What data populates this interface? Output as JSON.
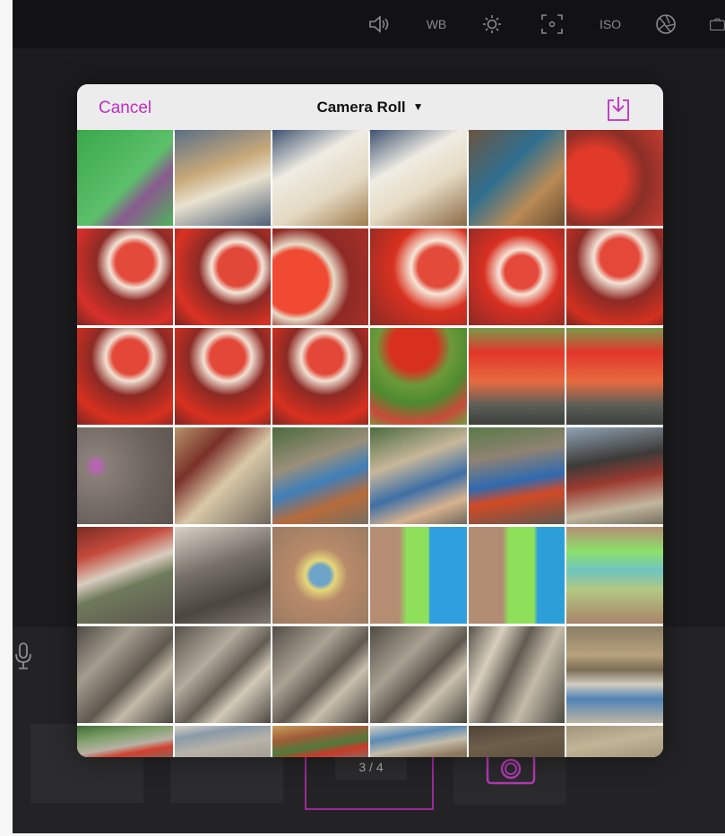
{
  "top_toolbar": {
    "tools": [
      {
        "icon": "speaker-icon",
        "label": ""
      },
      {
        "icon": "white-balance-label",
        "label": "WB"
      },
      {
        "icon": "brightness-icon",
        "label": ""
      },
      {
        "icon": "focus-frame-icon",
        "label": ""
      },
      {
        "icon": "iso-label",
        "label": "ISO"
      },
      {
        "icon": "aperture-icon",
        "label": ""
      },
      {
        "icon": "camera-switch-icon",
        "label": ""
      }
    ]
  },
  "picker": {
    "cancel_label": "Cancel",
    "album_title": "Camera Roll",
    "album_caret": "▼",
    "import_icon": "import-download-icon",
    "photos": [
      {
        "row": 0,
        "col": 0,
        "bg": "linear-gradient(135deg,#3aa84b 0%,#5cc06a 55%,#8a5a8e 70%,#4db35a 100%)"
      },
      {
        "row": 0,
        "col": 1,
        "bg": "linear-gradient(160deg,#5b6f86 0%,#c8a97a 40%,#e9e2cf 60%,#4d5f76 100%)"
      },
      {
        "row": 0,
        "col": 2,
        "bg": "linear-gradient(150deg,#3e5271 0%,#efece3 35%,#e3d9c3 65%,#a07c4c 100%)"
      },
      {
        "row": 0,
        "col": 3,
        "bg": "linear-gradient(150deg,#3e5271 0%,#efece3 35%,#e6dcc5 60%,#8b6a45 100%)"
      },
      {
        "row": 0,
        "col": 4,
        "bg": "linear-gradient(135deg,#6b5540 0%,#2f6f8f 40%,#b98a55 70%,#6a4f33 100%)"
      },
      {
        "row": 0,
        "col": 5,
        "bg": "radial-gradient(circle at 30% 50%,#e23a2a 0 35%,#8a2f27 60%,#c43b31 100%)"
      },
      {
        "row": 1,
        "col": 0,
        "bg": "radial-gradient(circle at 60% 35%,#e44a3a 0 22%,#f3e3d6 30%,#8d2b26 45%,#d8302a 75%,#7a2622 100%)"
      },
      {
        "row": 1,
        "col": 1,
        "bg": "radial-gradient(circle at 65% 40%,#e14838 0 22%,#f4e6d9 30%,#8b2a25 45%,#db3224 75%,#7b2420 100%)"
      },
      {
        "row": 1,
        "col": 2,
        "bg": "radial-gradient(circle at 25% 55%,#f04a32 0 35%,#e8dcc8 42%,#8f2a25 60%,#a83028 100%)"
      },
      {
        "row": 1,
        "col": 3,
        "bg": "radial-gradient(circle at 70% 40%,#e34a39 0 22%,#f5e6d8 30%,#d9311f 50%,#8a2a25 100%)"
      },
      {
        "row": 1,
        "col": 4,
        "bg": "radial-gradient(circle at 55% 45%,#e5493a 0 22%,#f4e5d7 30%,#d93022 50%,#8b2a25 100%)"
      },
      {
        "row": 1,
        "col": 5,
        "bg": "radial-gradient(circle at 55% 30%,#e44838 0 22%,#f3e3d6 30%,#8d2b26 50%,#d3301f 80%,#7a2622 100%)"
      },
      {
        "row": 2,
        "col": 0,
        "bg": "radial-gradient(circle at 55% 30%,#e24737 0 20%,#f2e1d3 28%,#8c2a25 45%,#d8301f 75%,#7a2622 100%)"
      },
      {
        "row": 2,
        "col": 1,
        "bg": "radial-gradient(circle at 55% 30%,#e24737 0 20%,#f2e1d3 28%,#8c2a25 45%,#d8301f 75%,#7a2622 100%)"
      },
      {
        "row": 2,
        "col": 2,
        "bg": "radial-gradient(circle at 55% 30%,#e24737 0 20%,#f2e1d3 28%,#8c2a25 45%,#d8301f 75%,#7a2622 100%)"
      },
      {
        "row": 2,
        "col": 3,
        "bg": "radial-gradient(circle at 45% 20%,#d8301f 0 25%,#6c9a3a 40%,#4f8a2f 60%,#c94a3a 80%,#6fa041 100%)"
      },
      {
        "row": 2,
        "col": 4,
        "bg": "linear-gradient(180deg,#7a9a4a 0%,#e2362a 25%,#e86a3f 55%,#5c5f58 80%,#3c3f3a 100%)"
      },
      {
        "row": 2,
        "col": 5,
        "bg": "linear-gradient(180deg,#7a9a4a 0%,#e2362a 25%,#e86a3f 55%,#5c5f58 80%,#3c3f3a 100%)"
      },
      {
        "row": 3,
        "col": 0,
        "bg": "radial-gradient(circle at 20% 40%,#b466b0 0 5%,#8a7f78 12%,#6b625c 60%,#5b534d 100%)"
      },
      {
        "row": 3,
        "col": 1,
        "bg": "linear-gradient(135deg,#b5946a 0%,#7a3028 30%,#d9c9a8 55%,#6f665c 100%)"
      },
      {
        "row": 3,
        "col": 2,
        "bg": "linear-gradient(160deg,#4b6b3e 0%,#9b8f7a 35%,#3f7fb9 55%,#b76b3a 75%,#776f63 100%)"
      },
      {
        "row": 3,
        "col": 3,
        "bg": "linear-gradient(160deg,#4b6b3e 0%,#c7b79a 35%,#3e6fa6 60%,#d7b28e 80%,#6e675d 100%)"
      },
      {
        "row": 3,
        "col": 4,
        "bg": "linear-gradient(170deg,#5a7a48 0%,#8f8273 30%,#2f6ab0 55%,#d24a25 70%,#5e5850 100%)"
      },
      {
        "row": 3,
        "col": 5,
        "bg": "linear-gradient(170deg,#8fa3b3 0%,#3d3a38 35%,#9b3a30 55%,#c2b69e 80%,#75705f 100%)"
      },
      {
        "row": 4,
        "col": 0,
        "bg": "linear-gradient(160deg,#7c2c25 0%,#c44a3c 25%,#d8cdbf 45%,#6f7a5b 60%,#5c574f 100%)"
      },
      {
        "row": 4,
        "col": 1,
        "bg": "linear-gradient(160deg,#d9d2c6 0%,#77706a 40%,#4a4640 70%,#807870 100%)"
      },
      {
        "row": 4,
        "col": 2,
        "bg": "radial-gradient(circle at 50% 50%,#6fa4c9 0 15%,#e5d87a 22%,#b88a6a 40%,#9b7b62 100%)"
      },
      {
        "row": 4,
        "col": 3,
        "bg": "linear-gradient(90deg,#b58d72 0%,#b58d72 30%,#8ee05a 38%,#8ee05a 60%,#2f9fe0 62%,#2f9fe0 100%)"
      },
      {
        "row": 4,
        "col": 4,
        "bg": "linear-gradient(90deg,#b28c73 0%,#b28c73 35%,#8ee05a 42%,#8ee05a 68%,#2c9fd8 72%,#2c9fd8 100%)"
      },
      {
        "row": 4,
        "col": 5,
        "bg": "linear-gradient(180deg,#b58f74 0%,#8de06a 25%,#6fc5c0 45%,#b3c882 65%,#a8846a 100%)"
      },
      {
        "row": 5,
        "col": 0,
        "bg": "linear-gradient(135deg,#4e4a44 0%,#a49c8e 30%,#5e584f 55%,#c4baa8 70%,#48443e 100%)"
      },
      {
        "row": 5,
        "col": 1,
        "bg": "linear-gradient(135deg,#56514a 0%,#b3ab9c 35%,#625c53 55%,#d2c9b7 70%,#4c4841 100%)"
      },
      {
        "row": 5,
        "col": 2,
        "bg": "linear-gradient(135deg,#524d46 0%,#aaa293 35%,#5f5950 55%,#c8bfac 70%,#4a463f 100%)"
      },
      {
        "row": 5,
        "col": 3,
        "bg": "linear-gradient(135deg,#4f4a43 0%,#a8a091 35%,#5d574e 55%,#c9c0ad 70%,#49453e 100%)"
      },
      {
        "row": 5,
        "col": 4,
        "bg": "linear-gradient(115deg,#57524a 0%,#d8cfbd 25%,#615b52 45%,#c4bba8 65%,#4d4942 100%)"
      },
      {
        "row": 5,
        "col": 5,
        "bg": "linear-gradient(180deg,#8a7e64 0%,#b7a27c 30%,#7a6c54 45%,#d2cdbf 60%,#4f82b6 75%,#bdb6a3 100%)"
      },
      {
        "row": 6,
        "col": 0,
        "bg": "linear-gradient(170deg,#3f6b35 0%,#7fa06a 30%,#b7b1a4 55%,#d3402f 70%,#756d62 100%)"
      },
      {
        "row": 6,
        "col": 1,
        "bg": "linear-gradient(170deg,#d8d3c8 0%,#8a9aa8 25%,#b8b3a8 55%,#9d968c 100%)"
      },
      {
        "row": 6,
        "col": 2,
        "bg": "linear-gradient(170deg,#c5a05a 0%,#a15c3a 30%,#4f7a3a 55%,#c93a2c 70%,#7d7469 100%)"
      },
      {
        "row": 6,
        "col": 3,
        "bg": "linear-gradient(170deg,#d4cfc4 0%,#5a8ab5 30%,#c4bbaa 55%,#8f7b5f 80%,#766d62 100%)"
      },
      {
        "row": 6,
        "col": 4,
        "bg": "linear-gradient(170deg,#4f4537 0%,#6d5e4a 45%,#5b4c3a 100%)"
      },
      {
        "row": 6,
        "col": 5,
        "bg": "linear-gradient(170deg,#a3957a 0%,#c1b497 45%,#9f8f72 100%)"
      }
    ]
  },
  "background_ui": {
    "page_counter": "3 / 4",
    "mic_icon": "microphone-icon",
    "camera_icon": "camera-icon"
  }
}
